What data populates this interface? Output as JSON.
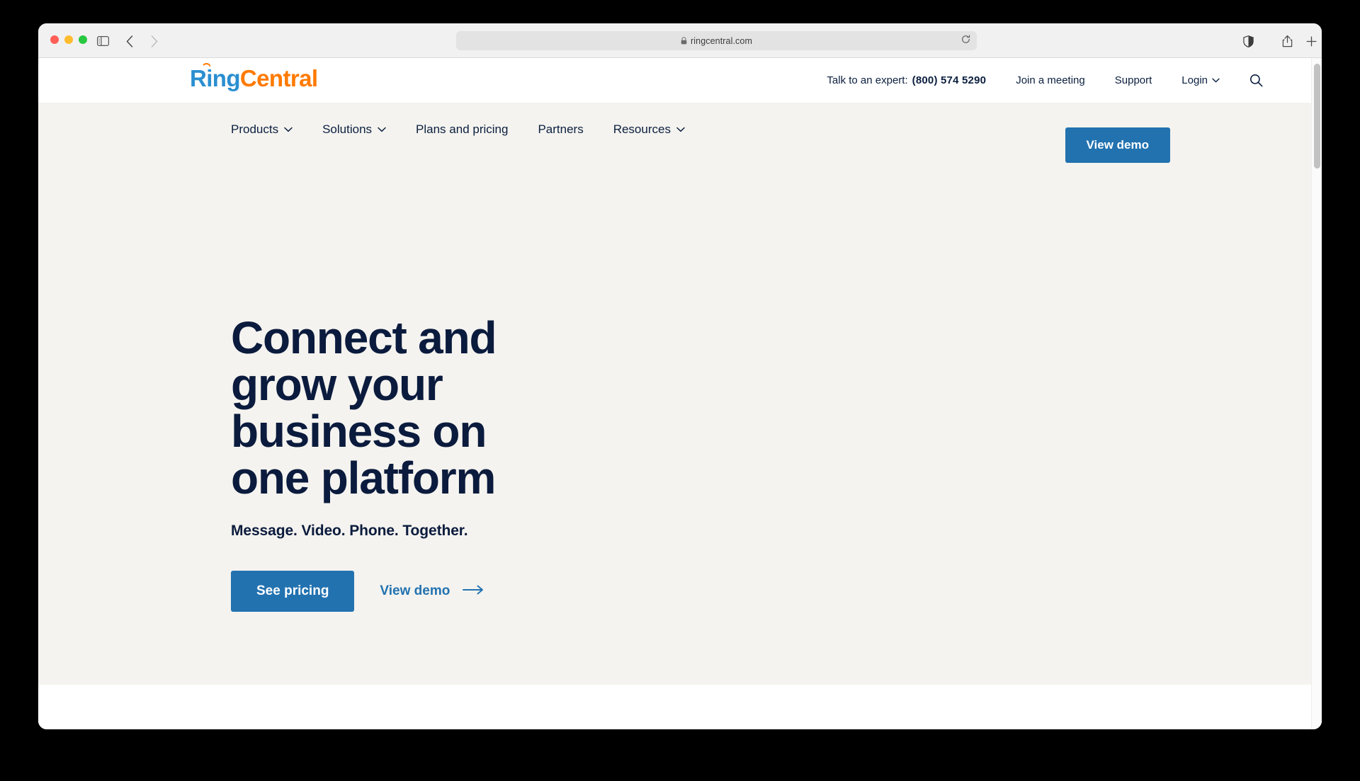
{
  "browser": {
    "traffic_lights": [
      "close",
      "minimize",
      "maximize"
    ],
    "sidebar_icon": "sidebar-icon",
    "back_icon": "chevron-left-icon",
    "forward_icon": "chevron-right-icon",
    "shield_icon": "privacy-shield-icon",
    "share_icon": "share-icon",
    "new_tab_icon": "plus-icon",
    "tab_overview_icon": "tab-overview-icon",
    "address": {
      "url": "ringcentral.com",
      "lock_icon": "lock-icon",
      "reload_icon": "reload-icon"
    }
  },
  "site": {
    "logo": {
      "part1": "Ring",
      "part2": "Central"
    },
    "utility_nav": {
      "expert_label": "Talk to an expert:",
      "expert_phone": "(800) 574 5290",
      "items": [
        {
          "label": "Join a meeting",
          "caret": false
        },
        {
          "label": "Support",
          "caret": false
        },
        {
          "label": "Login",
          "caret": true
        }
      ],
      "search_icon": "search-icon"
    },
    "main_nav": {
      "items": [
        {
          "label": "Products",
          "caret": "⌄"
        },
        {
          "label": "Solutions",
          "caret": "⌄"
        },
        {
          "label": "Plans and pricing",
          "caret": ""
        },
        {
          "label": "Partners",
          "caret": ""
        },
        {
          "label": "Resources",
          "caret": "⌄"
        }
      ],
      "cta_label": "View demo"
    },
    "hero": {
      "title": "Connect and grow your business on one platform",
      "subtitle": "Message. Video. Phone. Together.",
      "primary_cta": "See pricing",
      "secondary_cta": "View demo",
      "secondary_cta_icon": "arrow-right-icon"
    },
    "colors": {
      "brand_blue": "#2272b0",
      "logo_blue": "#2b8fd0",
      "logo_orange": "#ff7a00",
      "navy_text": "#0b1b3d",
      "hero_background": "#f4f3ef"
    }
  }
}
